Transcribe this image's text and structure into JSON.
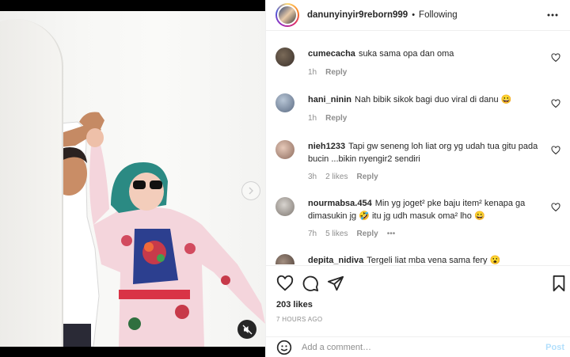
{
  "post": {
    "username": "danunyinyir9reborn999",
    "separator": "•",
    "follow_status": "Following",
    "likes": "203 likes",
    "time_ago": "7 HOURS AGO"
  },
  "comments": [
    {
      "user": "cumecacha",
      "text": "suka sama opa dan oma",
      "time": "1h",
      "likes": "",
      "reply": "Reply"
    },
    {
      "user": "hani_ninin",
      "text": "Nah bibik sikok bagi duo viral di danu 😀",
      "time": "1h",
      "likes": "",
      "reply": "Reply"
    },
    {
      "user": "nieh1233",
      "text": "Tapi gw seneng loh liat org yg udah tua gitu pada bucin ...bikin nyengir2 sendiri",
      "time": "3h",
      "likes": "2 likes",
      "reply": "Reply"
    },
    {
      "user": "nourmabsa.454",
      "text": "Min yg joget² pke baju item² kenapa ga dimasukin jg 🤣 itu jg udh masuk oma² lho 😀",
      "time": "7h",
      "likes": "5 likes",
      "reply": "Reply",
      "more": "•••"
    },
    {
      "user": "depita_nidiva",
      "text": "Tergeli liat mba vena sama fery 😮",
      "time": "",
      "likes": "",
      "reply": ""
    }
  ],
  "add_comment": {
    "placeholder": "Add a comment…",
    "post_label": "Post"
  },
  "icons": {
    "more": "more-options-icon",
    "like": "heart-icon",
    "comment": "comment-icon",
    "share": "paper-plane-icon",
    "save": "bookmark-icon",
    "emoji": "emoji-icon",
    "next": "chevron-right-icon",
    "mute": "muted-speaker-icon"
  },
  "colors": {
    "text": "#262626",
    "muted": "#8e8e8e",
    "post_disabled": "#b2dffc",
    "border": "#efefef"
  }
}
